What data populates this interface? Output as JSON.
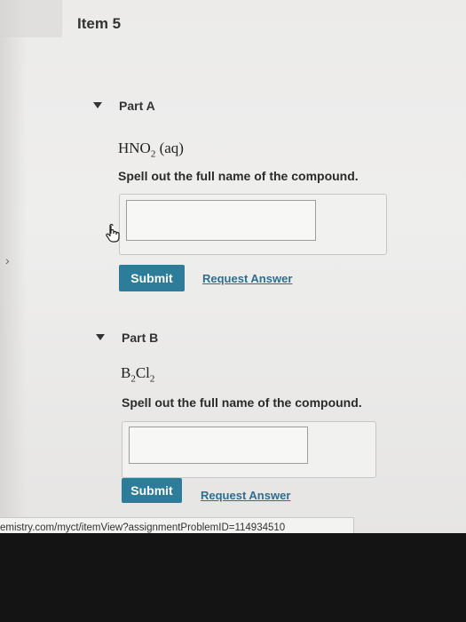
{
  "item": {
    "title": "Item 5"
  },
  "parts": [
    {
      "title": "Part A",
      "formula": {
        "main": "HNO",
        "sub": "2",
        "suffix": " (aq)"
      },
      "question": "Spell out the full name of the compound.",
      "answer_value": "",
      "submit_label": "Submit",
      "request_label": "Request Answer"
    },
    {
      "title": "Part B",
      "formula": {
        "a": "B",
        "a_sub": "2",
        "b": "Cl",
        "b_sub": "2"
      },
      "question": "Spell out the full name of the compound.",
      "answer_value": "",
      "submit_label": "Submit",
      "request_label": "Request Answer"
    }
  ],
  "nav": {
    "chevron": "›"
  },
  "status_bar": {
    "url": "emistry.com/myct/itemView?assignmentProblemID=114934510"
  },
  "colors": {
    "submit": "#2d7c99",
    "link": "#2f6e8c",
    "background": "#ecebea"
  }
}
